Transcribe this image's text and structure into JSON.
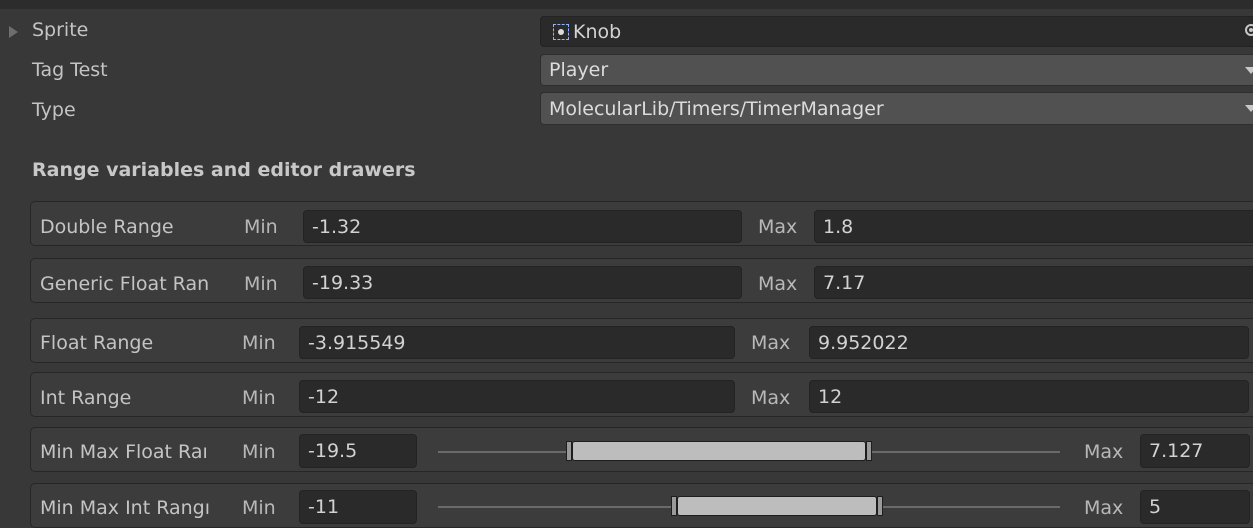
{
  "properties": {
    "sprite": {
      "label": "Sprite",
      "value": "Knob",
      "icon": "sprite-icon",
      "picker_icon": "object-picker-icon"
    },
    "tag_test": {
      "label": "Tag Test",
      "value": "Player"
    },
    "type": {
      "label": "Type",
      "value": "MolecularLib/Timers/TimerManager"
    }
  },
  "section": {
    "header": "Range variables and editor drawers"
  },
  "ranges": [
    {
      "label": "Double Range",
      "min_label": "Min",
      "min": "-1.32",
      "max_label": "Max",
      "max": "1.8"
    },
    {
      "label": "Generic Float Ran",
      "min_label": "Min",
      "min": "-19.33",
      "max_label": "Max",
      "max": "7.17"
    },
    {
      "label": "Float Range",
      "min_label": "Min",
      "min": "-3.915549",
      "max_label": "Max",
      "max": "9.952022"
    },
    {
      "label": "Int Range",
      "min_label": "Min",
      "min": "-12",
      "max_label": "Max",
      "max": "12"
    },
    {
      "label": "Min Max Float Raı",
      "min_label": "Min",
      "min": "-19.5",
      "max_label": "Max",
      "max": "7.127"
    },
    {
      "label": "Min Max Int Rangı",
      "min_label": "Min",
      "min": "-11",
      "max_label": "Max",
      "max": "5"
    }
  ]
}
